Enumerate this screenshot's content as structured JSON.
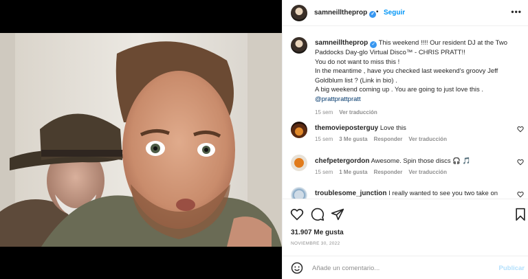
{
  "post": {
    "username": "samneilltheprop",
    "verified_icon": "verified-badge-icon",
    "separator": "•",
    "follow_label": "Seguir",
    "more_icon": "more-options-icon"
  },
  "caption": {
    "username": "samneilltheprop",
    "lines": [
      "This weekend !!!! Our resident DJ at the Two Paddocks Day-glo Virtual Disco™ - CHRIS PRATT!!",
      "You do not want to miss this !",
      "In the meantime , have you checked last weekend's groovy Jeff Goldblum list ? (Link in bio) .",
      "A big weekend coming up . You are going to just love this ."
    ],
    "mention": "@prattprattpratt",
    "time": "15 sem",
    "translate_label": "Ver traducción"
  },
  "comments": [
    {
      "username": "themovieposterguy",
      "text": "Love this",
      "time": "15 sem",
      "likes": "3 Me gusta",
      "reply_label": "Responder",
      "translate_label": "Ver traducción"
    },
    {
      "username": "chefpetergordon",
      "text": "Awesome. Spin those discs 🎧 🎵",
      "time": "15 sem",
      "likes": "1 Me gusta",
      "reply_label": "Responder",
      "translate_label": "Ver traducción"
    },
    {
      "username": "troublesome_junction",
      "text": "I really wanted to see you two take on"
    }
  ],
  "actions": {
    "like_icon": "heart-icon",
    "comment_icon": "comment-icon",
    "share_icon": "share-icon",
    "save_icon": "bookmark-icon",
    "likes_count": "31.907 Me gusta",
    "date": "NOVIEMBRE 30, 2022"
  },
  "add_comment": {
    "emoji_icon": "emoji-icon",
    "placeholder": "Añade un comentario...",
    "publish_label": "Publicar"
  },
  "colors": {
    "accent": "#0095f6",
    "verified": "#3897f0",
    "muted": "#8e8e8e",
    "publish_disabled": "#b2dffc"
  }
}
